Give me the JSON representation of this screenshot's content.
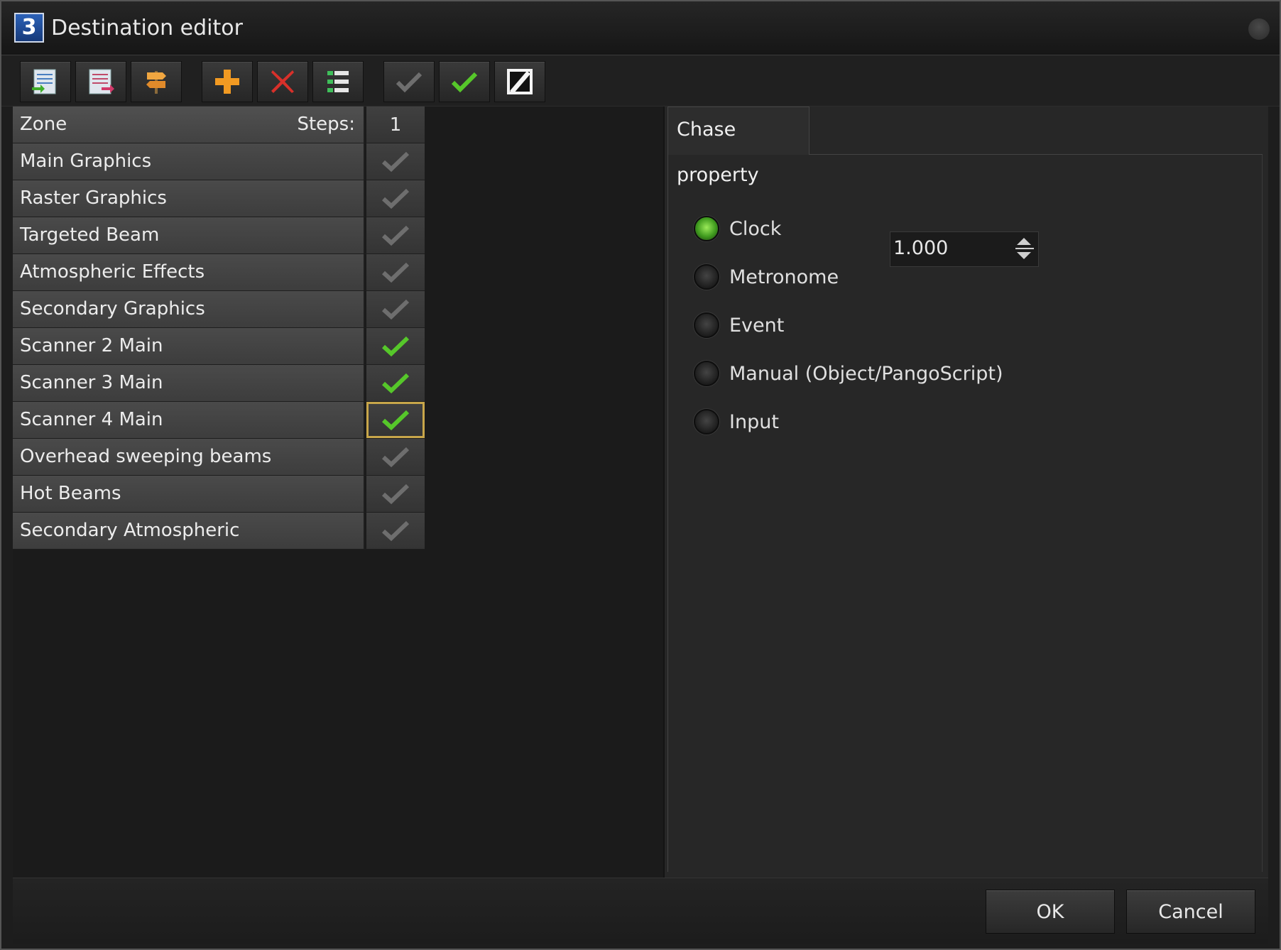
{
  "window": {
    "title": "Destination editor"
  },
  "toolbar": {
    "icons": [
      "zone-import-icon",
      "zone-export-icon",
      "signpost-icon",
      "add-icon",
      "delete-icon",
      "list-align-icon",
      "check-gray-icon",
      "check-green-icon",
      "invert-icon"
    ]
  },
  "zone_table": {
    "header": {
      "zone_label": "Zone",
      "steps_label": "Steps:",
      "steps_value": "1"
    },
    "rows": [
      {
        "name": "Main Graphics",
        "checked": false
      },
      {
        "name": "Raster Graphics",
        "checked": false
      },
      {
        "name": "Targeted Beam",
        "checked": false
      },
      {
        "name": "Atmospheric Effects",
        "checked": false
      },
      {
        "name": "Secondary Graphics",
        "checked": false
      },
      {
        "name": "Scanner  2 Main",
        "checked": true
      },
      {
        "name": "Scanner  3 Main",
        "checked": true
      },
      {
        "name": "Scanner  4 Main",
        "checked": true
      },
      {
        "name": "Overhead sweeping beams",
        "checked": false
      },
      {
        "name": "Hot Beams",
        "checked": false
      },
      {
        "name": "Secondary Atmospheric",
        "checked": false
      }
    ]
  },
  "chase": {
    "tab_label": "Chase property",
    "options": [
      {
        "label": "Clock",
        "selected": true
      },
      {
        "label": "Metronome",
        "selected": false
      },
      {
        "label": "Event",
        "selected": false
      },
      {
        "label": "Manual (Object/PangoScript)",
        "selected": false
      },
      {
        "label": "Input",
        "selected": false
      }
    ],
    "clock_value": "1.000"
  },
  "buttons": {
    "ok": "OK",
    "cancel": "Cancel"
  },
  "colors": {
    "check_on": "#56c72a",
    "check_off": "#6e6e6e",
    "selected_border": "#c8a64a",
    "radio_on": "#5fbf2a"
  }
}
